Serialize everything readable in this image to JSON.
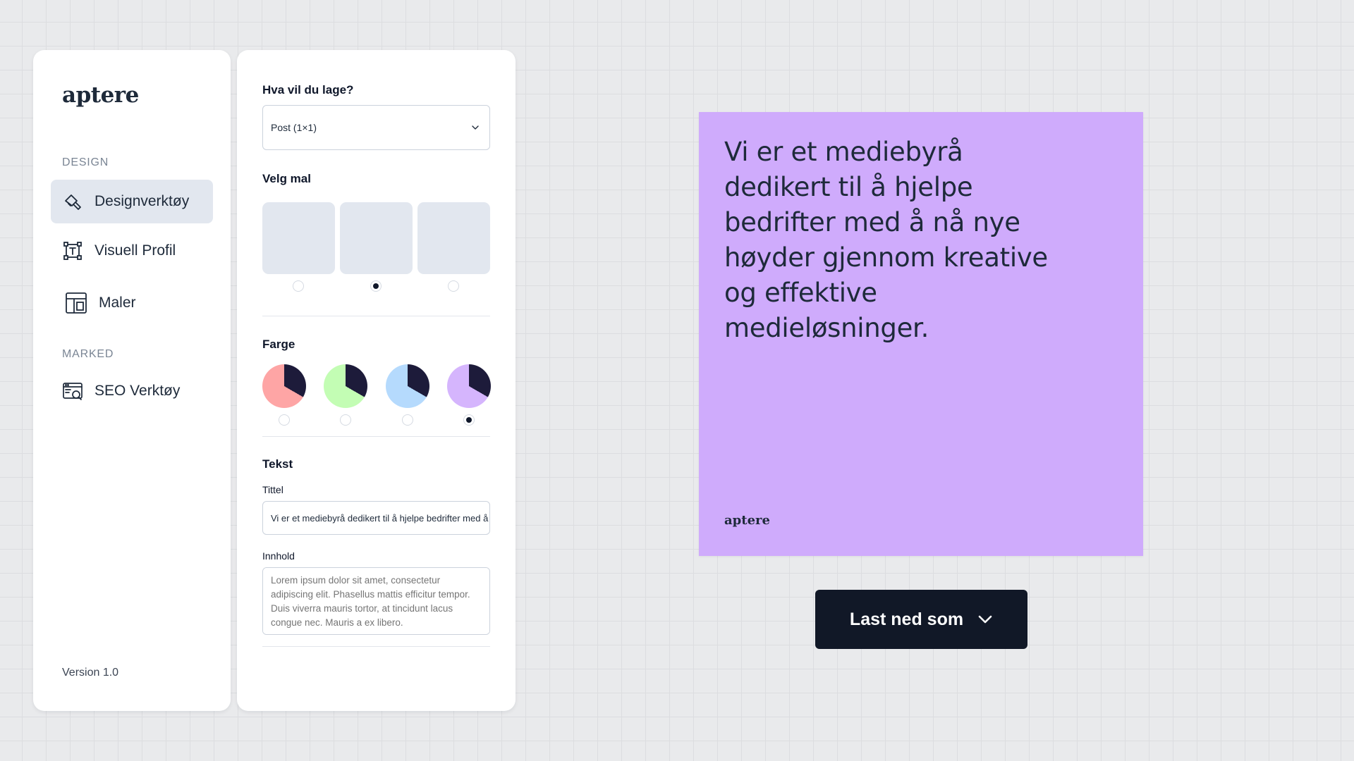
{
  "sidebar": {
    "logo": "aptere",
    "sections": [
      {
        "label": "DESIGN",
        "items": [
          {
            "label": "Designverktøy",
            "icon": "brush-icon",
            "active": true
          },
          {
            "label": "Visuell Profil",
            "icon": "text-frame-icon",
            "active": false
          },
          {
            "label": "Maler",
            "icon": "layout-icon",
            "active": false
          }
        ]
      },
      {
        "label": "MARKED",
        "items": [
          {
            "label": "SEO Verktøy",
            "icon": "browser-search-icon",
            "active": false
          }
        ]
      }
    ],
    "version": "Version 1.0"
  },
  "form": {
    "format_title": "Hva vil du lage?",
    "format_value": "Post (1×1)",
    "template_title": "Velg mal",
    "template_selected": 1,
    "color_title": "Farge",
    "colors": [
      "#fea5a5",
      "#c3fdb4",
      "#b5dafd",
      "#d5b5fd"
    ],
    "color_accent": "#1d1b3a",
    "color_selected": 3,
    "text_title": "Tekst",
    "title_label": "Tittel",
    "title_value": "Vi er et mediebyrå dedikert til å hjelpe bedrifter med å nå nye høyder gjennom kreative og effektive medieløsninger.",
    "content_label": "Innhold",
    "content_placeholder": "Lorem ipsum dolor sit amet, consectetur adipiscing elit. Phasellus mattis efficitur tempor. Duis viverra mauris tortor, at tincidunt lacus congue nec. Mauris a ex libero."
  },
  "preview": {
    "background": "#cfabfc",
    "text": "Vi er et mediebyrå dedikert til å hjelpe bedrifter med å nå nye høyder gjennom kreative og effektive medieløsninger.",
    "logo": "aptere"
  },
  "download": {
    "label": "Last ned som",
    "background": "#111827"
  }
}
